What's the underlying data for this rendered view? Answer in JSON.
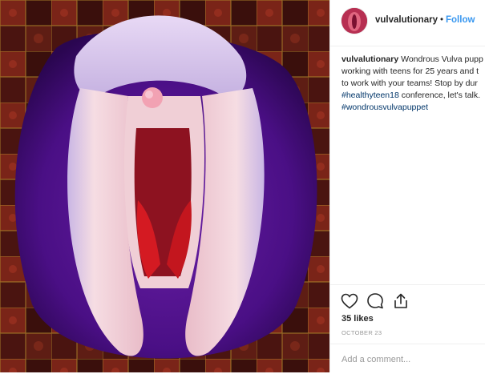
{
  "post": {
    "photo_alt": "felt puppet photo",
    "username": "vulvalutionary",
    "separator": "•",
    "follow_label": "Follow",
    "caption": {
      "username": "vulvalutionary",
      "line1": "Wondrous Vulva pupp",
      "line2": "working with teens for 25 years and t",
      "line3": "to work with your teams! Stop by dur",
      "hashtag1": "#healthyteen18",
      "line4_rest": " conference, let's talk.",
      "hashtag2": "#wondrousvulvapuppet"
    },
    "actions": {
      "like_icon": "heart-icon",
      "comment_icon": "comment-icon",
      "share_icon": "share-icon"
    },
    "likes": "35 likes",
    "date": "OCTOBER 23",
    "comment_placeholder": "Add a comment..."
  },
  "colors": {
    "link_blue": "#3897f0",
    "hashtag": "#003569",
    "text": "#262626",
    "muted": "#999999",
    "border": "#efefef"
  }
}
